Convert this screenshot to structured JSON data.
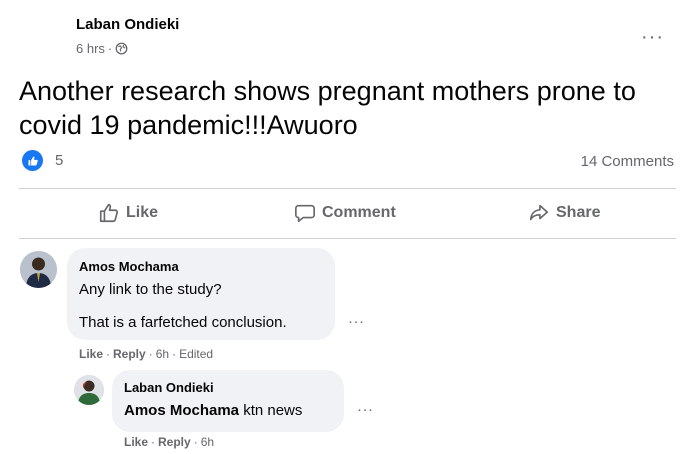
{
  "post": {
    "author": "Laban Ondieki",
    "time": "6 hrs",
    "meta_sep": "·",
    "text": "Another research shows pregnant mothers prone to covid 19 pandemic!!!Awuoro",
    "reaction_count": "5",
    "comment_count": "14 Comments",
    "more_label": "···"
  },
  "actions": {
    "like": "Like",
    "comment": "Comment",
    "share": "Share"
  },
  "comments": [
    {
      "author": "Amos Mochama",
      "lines": [
        "Any link to the study?",
        "That is a farfetched conclusion."
      ],
      "like": "Like",
      "reply": "Reply",
      "time": "6h",
      "edited": "Edited",
      "sep": "·",
      "more": "···"
    },
    {
      "author": "Laban Ondieki",
      "mention": "Amos Mochama",
      "text": " ktn news",
      "like": "Like",
      "reply": "Reply",
      "time": "6h",
      "sep": "·",
      "more": "···"
    }
  ],
  "colors": {
    "accent": "#1877f2",
    "secondary_text": "#65676b",
    "bubble_bg": "#f0f2f5",
    "divider": "#ced0d4"
  },
  "icons": [
    "globe-icon",
    "like-reaction-icon",
    "thumbs-up-icon",
    "comment-icon",
    "share-icon",
    "more-options-icon"
  ]
}
